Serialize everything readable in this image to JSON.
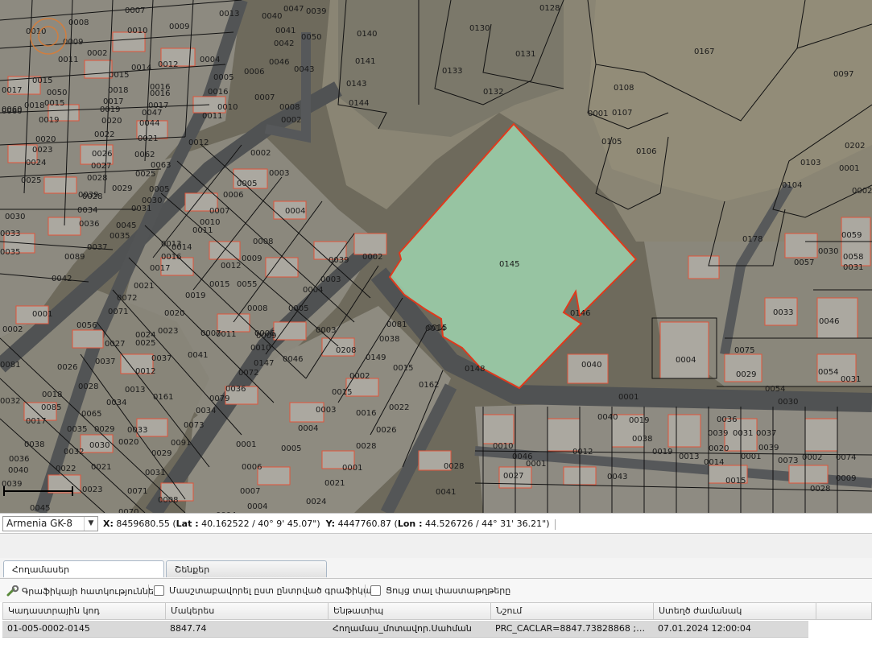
{
  "map": {
    "highlighted_parcel": "0145",
    "labels": [
      {
        "t": "0010"
      },
      {
        "t": "0008"
      },
      {
        "t": "0007"
      },
      {
        "t": "0013"
      },
      {
        "t": "0040"
      },
      {
        "t": "0047"
      },
      {
        "t": "0039"
      },
      {
        "t": "0128"
      },
      {
        "t": "0009"
      },
      {
        "t": "0010"
      },
      {
        "t": "0009"
      },
      {
        "t": "0041"
      },
      {
        "t": "0050"
      },
      {
        "t": "0130"
      },
      {
        "t": "0140"
      },
      {
        "t": "0011"
      },
      {
        "t": "0002"
      },
      {
        "t": "0012"
      },
      {
        "t": "0004"
      },
      {
        "t": "0042"
      },
      {
        "t": "0131"
      },
      {
        "t": "0167"
      },
      {
        "t": "0017"
      },
      {
        "t": "0016"
      },
      {
        "t": "0015"
      },
      {
        "t": "0014"
      },
      {
        "t": "0006"
      },
      {
        "t": "0046"
      },
      {
        "t": "0043"
      },
      {
        "t": "0141"
      },
      {
        "t": "0133"
      },
      {
        "t": "0097"
      },
      {
        "t": "0015"
      },
      {
        "t": "0018"
      },
      {
        "t": "0016"
      },
      {
        "t": "0005"
      },
      {
        "t": "0143"
      },
      {
        "t": "0132"
      },
      {
        "t": "0108"
      },
      {
        "t": "0017"
      },
      {
        "t": "0050"
      },
      {
        "t": "0060"
      },
      {
        "t": "0017"
      },
      {
        "t": "0016"
      },
      {
        "t": "0007"
      },
      {
        "t": "0144"
      },
      {
        "t": "0060"
      },
      {
        "t": "0018"
      },
      {
        "t": "0015"
      },
      {
        "t": "0019"
      },
      {
        "t": "0047"
      },
      {
        "t": "0010"
      },
      {
        "t": "0008"
      },
      {
        "t": "0001"
      },
      {
        "t": "0107"
      },
      {
        "t": "0019"
      },
      {
        "t": "0020"
      },
      {
        "t": "0044"
      },
      {
        "t": "0011"
      },
      {
        "t": "0002"
      },
      {
        "t": "0022"
      },
      {
        "t": "0021"
      },
      {
        "t": "0105"
      },
      {
        "t": "0020"
      },
      {
        "t": "0012"
      },
      {
        "t": "0023"
      },
      {
        "t": "0026"
      },
      {
        "t": "0062"
      },
      {
        "t": "0002"
      },
      {
        "t": "0106"
      },
      {
        "t": "0202"
      },
      {
        "t": "0024"
      },
      {
        "t": "0027"
      },
      {
        "t": "0063"
      },
      {
        "t": "0103"
      },
      {
        "t": "0001"
      },
      {
        "t": "0025"
      },
      {
        "t": "0028"
      },
      {
        "t": "0025"
      },
      {
        "t": "0003"
      },
      {
        "t": "0104"
      },
      {
        "t": "0005"
      },
      {
        "t": "0005"
      },
      {
        "t": "0002"
      },
      {
        "t": "0029"
      },
      {
        "t": "0028"
      },
      {
        "t": "0039"
      },
      {
        "t": "0030"
      },
      {
        "t": "0006"
      },
      {
        "t": "0004"
      },
      {
        "t": "0030"
      },
      {
        "t": "0034"
      },
      {
        "t": "0031"
      },
      {
        "t": "0007"
      },
      {
        "t": "0036"
      },
      {
        "t": "0045"
      },
      {
        "t": "0035"
      },
      {
        "t": "0010"
      },
      {
        "t": "0011"
      },
      {
        "t": "0008"
      },
      {
        "t": "0178"
      },
      {
        "t": "0059"
      },
      {
        "t": "0033"
      },
      {
        "t": "0037"
      },
      {
        "t": "0013"
      },
      {
        "t": "0014"
      },
      {
        "t": "0039"
      },
      {
        "t": "0002"
      },
      {
        "t": "0030"
      },
      {
        "t": "0058"
      },
      {
        "t": "0035"
      },
      {
        "t": "0089"
      },
      {
        "t": "0016"
      },
      {
        "t": "0009"
      },
      {
        "t": "0057"
      },
      {
        "t": "0031"
      },
      {
        "t": "0017"
      },
      {
        "t": "0012"
      },
      {
        "t": "0003"
      },
      {
        "t": "0145"
      },
      {
        "t": "0042"
      },
      {
        "t": "0021"
      },
      {
        "t": "0015"
      },
      {
        "t": "0055"
      },
      {
        "t": "0004"
      },
      {
        "t": "0072"
      },
      {
        "t": "0019"
      },
      {
        "t": "0005"
      },
      {
        "t": "0008"
      },
      {
        "t": "0146"
      },
      {
        "t": "0033"
      },
      {
        "t": "0001"
      },
      {
        "t": "0071"
      },
      {
        "t": "0020"
      },
      {
        "t": "0007"
      },
      {
        "t": "0006"
      },
      {
        "t": "0046"
      },
      {
        "t": "0002"
      },
      {
        "t": "0056"
      },
      {
        "t": "0024"
      },
      {
        "t": "0023"
      },
      {
        "t": "0011"
      },
      {
        "t": "0009"
      },
      {
        "t": "0081"
      },
      {
        "t": "0027"
      },
      {
        "t": "0025"
      },
      {
        "t": "0038"
      },
      {
        "t": "0015"
      },
      {
        "t": "0003"
      },
      {
        "t": "0010"
      },
      {
        "t": "0014"
      },
      {
        "t": "0041"
      },
      {
        "t": "0046"
      },
      {
        "t": "0208"
      },
      {
        "t": "0075"
      },
      {
        "t": "0037"
      },
      {
        "t": "0149"
      },
      {
        "t": "0004"
      },
      {
        "t": "0081"
      },
      {
        "t": "0037"
      },
      {
        "t": "0147"
      },
      {
        "t": "0040"
      },
      {
        "t": "0054"
      },
      {
        "t": "0026"
      },
      {
        "t": "0012"
      },
      {
        "t": "0072"
      },
      {
        "t": "0015"
      },
      {
        "t": "0148"
      },
      {
        "t": "0029"
      },
      {
        "t": "0031"
      },
      {
        "t": "0028"
      },
      {
        "t": "0013"
      },
      {
        "t": "0036"
      },
      {
        "t": "0002"
      },
      {
        "t": "0162"
      },
      {
        "t": "0054"
      },
      {
        "t": "0032"
      },
      {
        "t": "0018"
      },
      {
        "t": "0161"
      },
      {
        "t": "0001"
      },
      {
        "t": "0030"
      },
      {
        "t": "0034"
      },
      {
        "t": "0085"
      },
      {
        "t": "0015"
      },
      {
        "t": "0079"
      },
      {
        "t": "0065"
      },
      {
        "t": "0017"
      },
      {
        "t": "0034"
      },
      {
        "t": "0003"
      },
      {
        "t": "0022"
      },
      {
        "t": "0040"
      },
      {
        "t": "0019"
      },
      {
        "t": "0073"
      },
      {
        "t": "0016"
      },
      {
        "t": "0036"
      },
      {
        "t": "0035"
      },
      {
        "t": "0029"
      },
      {
        "t": "0033"
      },
      {
        "t": "0004"
      },
      {
        "t": "0026"
      },
      {
        "t": "0038"
      },
      {
        "t": "0039"
      },
      {
        "t": "0031"
      },
      {
        "t": "0037"
      },
      {
        "t": "0030"
      },
      {
        "t": "0020"
      },
      {
        "t": "0091"
      },
      {
        "t": "0001"
      },
      {
        "t": "0010"
      },
      {
        "t": "0019"
      },
      {
        "t": "0020"
      },
      {
        "t": "0039"
      },
      {
        "t": "0038"
      },
      {
        "t": "0032"
      },
      {
        "t": "0005"
      },
      {
        "t": "0028"
      },
      {
        "t": "0046"
      },
      {
        "t": "0012"
      },
      {
        "t": "0013"
      },
      {
        "t": "0014"
      },
      {
        "t": "0001"
      },
      {
        "t": "0073"
      },
      {
        "t": "0036"
      },
      {
        "t": "0021"
      },
      {
        "t": "0029"
      },
      {
        "t": "0001"
      },
      {
        "t": "0028"
      },
      {
        "t": "0002"
      },
      {
        "t": "0074"
      },
      {
        "t": "0040"
      },
      {
        "t": "0022"
      },
      {
        "t": "0031"
      },
      {
        "t": "0006"
      },
      {
        "t": "0001"
      },
      {
        "t": "0027"
      },
      {
        "t": "0009"
      },
      {
        "t": "0043"
      },
      {
        "t": "0039"
      },
      {
        "t": "0023"
      },
      {
        "t": "0071"
      },
      {
        "t": "0007"
      },
      {
        "t": "0021"
      },
      {
        "t": "0041"
      },
      {
        "t": "0015"
      },
      {
        "t": "0045"
      },
      {
        "t": "0070"
      },
      {
        "t": "0008"
      },
      {
        "t": "0004"
      },
      {
        "t": "0004"
      },
      {
        "t": "0024"
      },
      {
        "t": "0028"
      },
      {
        "t": "0029"
      },
      {
        "t": "0005"
      },
      {
        "t": "0032"
      },
      {
        "t": "0002"
      },
      {
        "t": "0031"
      }
    ]
  },
  "statusbar": {
    "crs": "Armenia GK-8",
    "x_label": "X:",
    "x_value": "8459680.55",
    "lat_label": "Lat :",
    "lat_value": "40.162522 / 40° 9' 45.07\"",
    "y_label": "Y:",
    "y_value": "4447760.87",
    "lon_label": "Lon :",
    "lon_value": "44.526726 / 44° 31' 36.21\""
  },
  "tabs": [
    {
      "label": "Հողամասեր",
      "active": true
    },
    {
      "label": "Շենքեր",
      "active": false
    }
  ],
  "toolbar": {
    "graphic_props": "Գրաֆիկայի հատկություններ",
    "zoom_to_selected": "Մասշտաբավորել ըստ ընտրված գրաֆիկայի",
    "show_docs": "Ցույց տալ փաստաթղթերը"
  },
  "table": {
    "columns": [
      "Կադաստրային կոդ",
      "Մակերես",
      "Ենթատիպ",
      "Նշում",
      "Ստեղծ ժամանակ"
    ],
    "rows": [
      [
        "01-005-0002-0145",
        "8847.74",
        "Հողամաս_մոտավոր.Սահման",
        "PRC_CACLAR=8847.73828868 ; P...",
        "07.01.2024 12:00:04"
      ]
    ]
  },
  "colors": {
    "parcel_fill": "#9fd4ae",
    "parcel_stroke": "#e0391c",
    "parcel_lines": "#111111",
    "building_outline": "#e2543a"
  }
}
